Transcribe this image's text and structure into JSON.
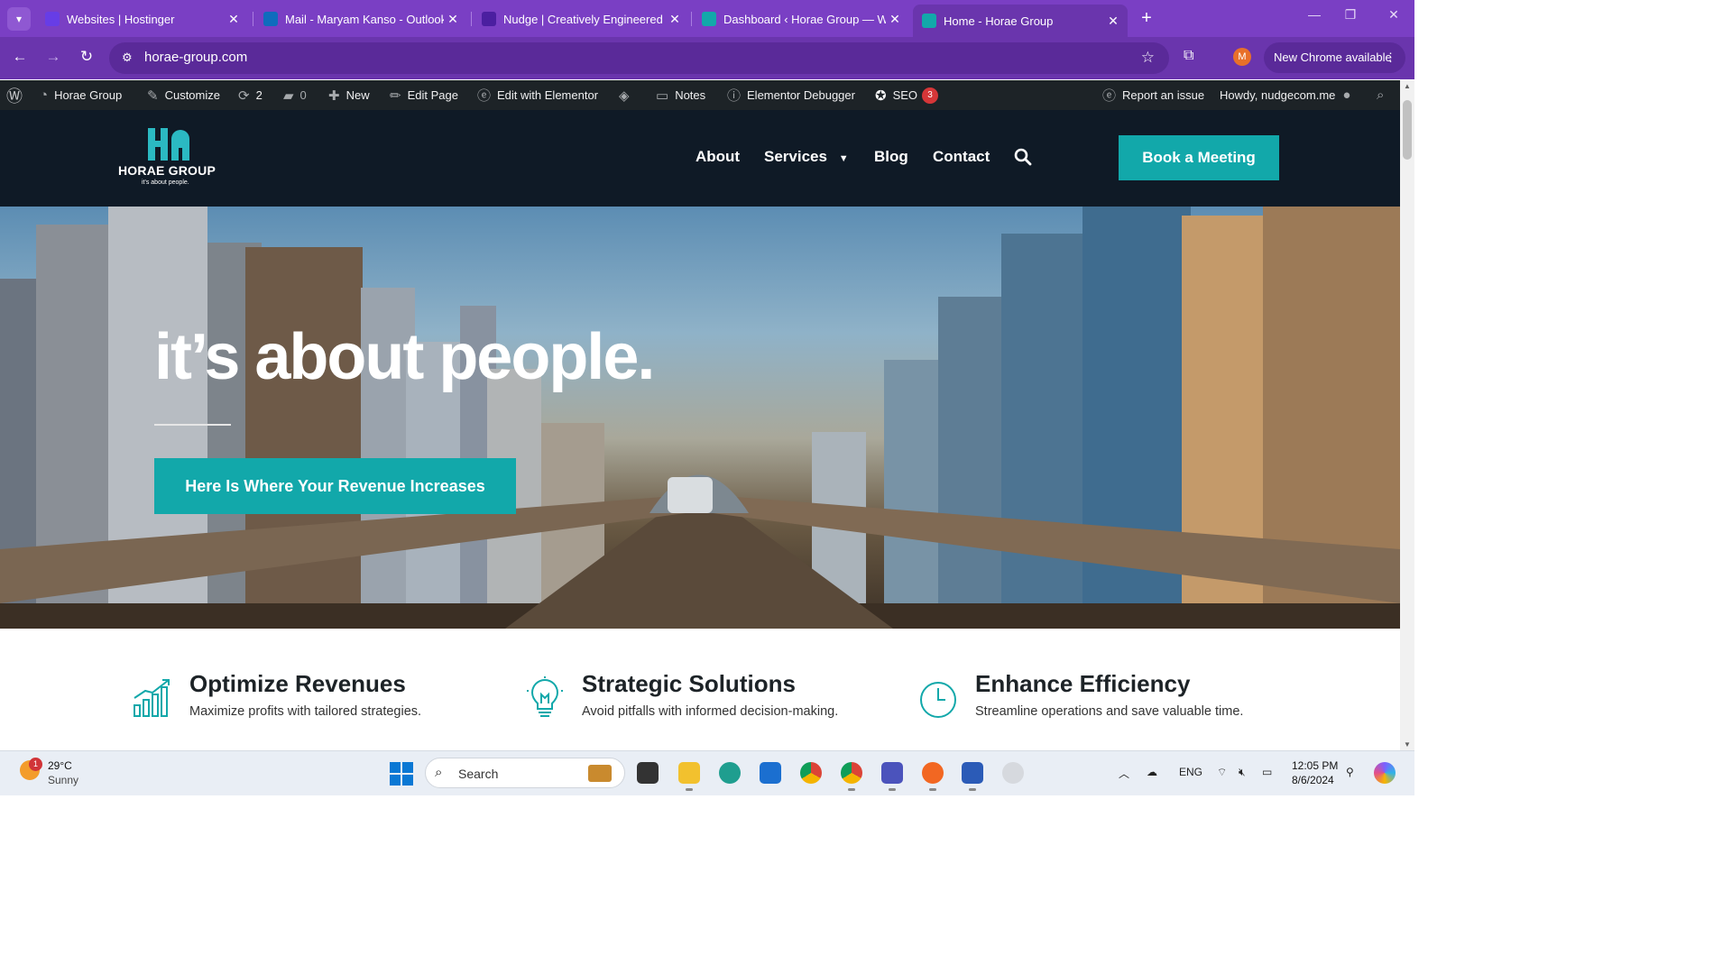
{
  "browser": {
    "tabs": [
      {
        "label": "Websites | Hostinger",
        "color": "#673de6"
      },
      {
        "label": "Mail - Maryam Kanso - Outlook",
        "color": "#0f6cbd"
      },
      {
        "label": "Nudge | Creatively Engineered C",
        "color": "#4b1fa0"
      },
      {
        "label": "Dashboard ‹ Horae Group — W",
        "color": "#12a8aa"
      },
      {
        "label": "Home - Horae Group",
        "color": "#12a8aa"
      }
    ],
    "url": "horae-group.com",
    "new_chrome_label": "New Chrome available",
    "profile_initial": "M"
  },
  "wp_admin_bar": {
    "site_name": "Horae Group",
    "customize": "Customize",
    "updates_count": "2",
    "comments_count": "0",
    "new": "New",
    "edit_page": "Edit Page",
    "edit_elementor": "Edit with Elementor",
    "notes": "Notes",
    "elementor_debugger": "Elementor Debugger",
    "seo": "SEO",
    "seo_count": "3",
    "report_issue": "Report an issue",
    "howdy": "Howdy, nudgecom.me"
  },
  "site": {
    "logo_name": "HORAE GROUP",
    "logo_tagline": "it's about people.",
    "nav": [
      "About",
      "Services",
      "Blog",
      "Contact"
    ],
    "cta": "Book a Meeting",
    "accent_color": "#12a8aa",
    "header_bg": "#0f1a26"
  },
  "hero": {
    "title": "it’s about people.",
    "button": "Here Is Where Your Revenue Increases"
  },
  "features": [
    {
      "icon": "bar-chart-icon",
      "title": "Optimize Revenues",
      "desc": "Maximize profits with tailored strategies."
    },
    {
      "icon": "lightbulb-icon",
      "title": "Strategic Solutions",
      "desc": "Avoid pitfalls with informed decision-making."
    },
    {
      "icon": "clock-icon",
      "title": "Enhance Efficiency",
      "desc": "Streamline operations and save valuable time."
    }
  ],
  "taskbar": {
    "weather_temp": "29°C",
    "weather_cond": "Sunny",
    "weather_badge": "1",
    "search_label": "Search",
    "lang": "ENG",
    "time": "12:05 PM",
    "date": "8/6/2024"
  }
}
